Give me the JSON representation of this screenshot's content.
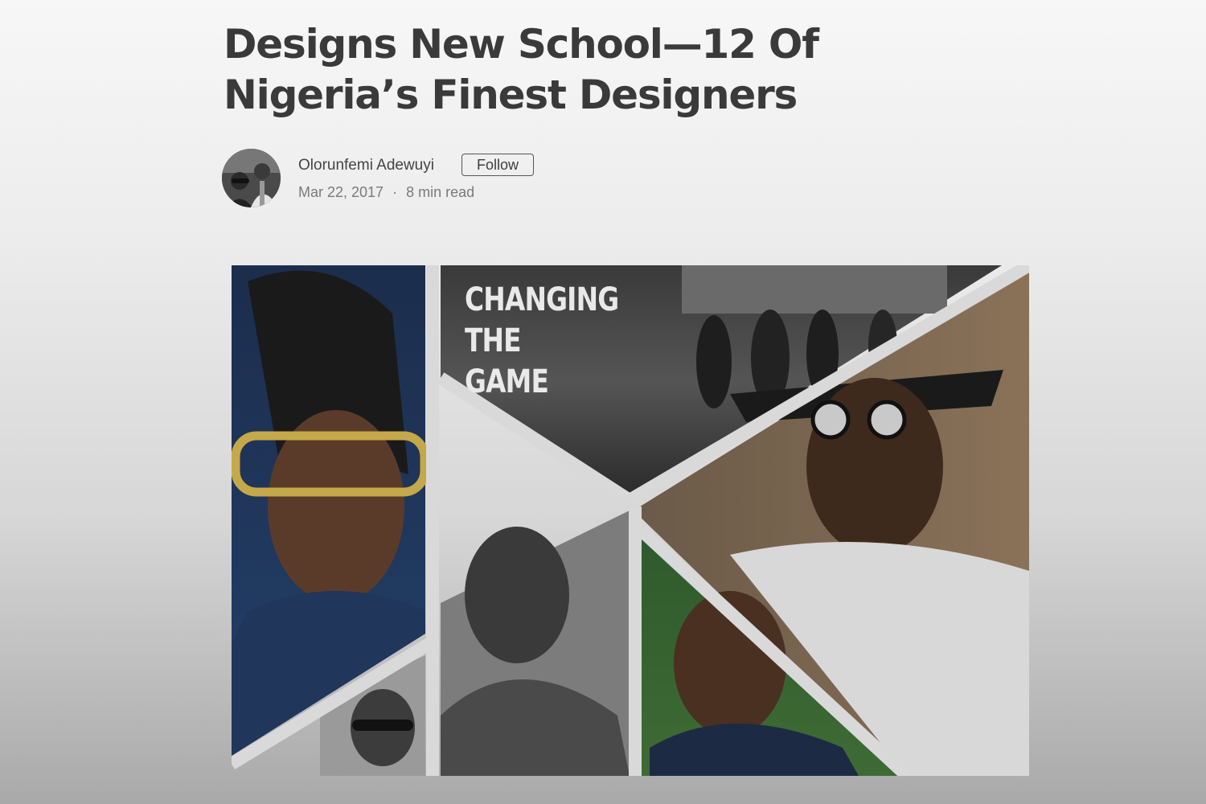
{
  "article": {
    "title": "Designs New School—12 Of Nigeria’s Finest Designers",
    "author": {
      "name": "Olorunfemi Adewuyi",
      "follow_label": "Follow",
      "avatar_icon": "avatar-photo"
    },
    "meta": {
      "date": "Mar 22, 2017",
      "separator": "·",
      "read_time": "8 min read"
    },
    "hero_image": {
      "overlay_text": [
        "CHANGING",
        "THE",
        "GAME"
      ]
    }
  }
}
